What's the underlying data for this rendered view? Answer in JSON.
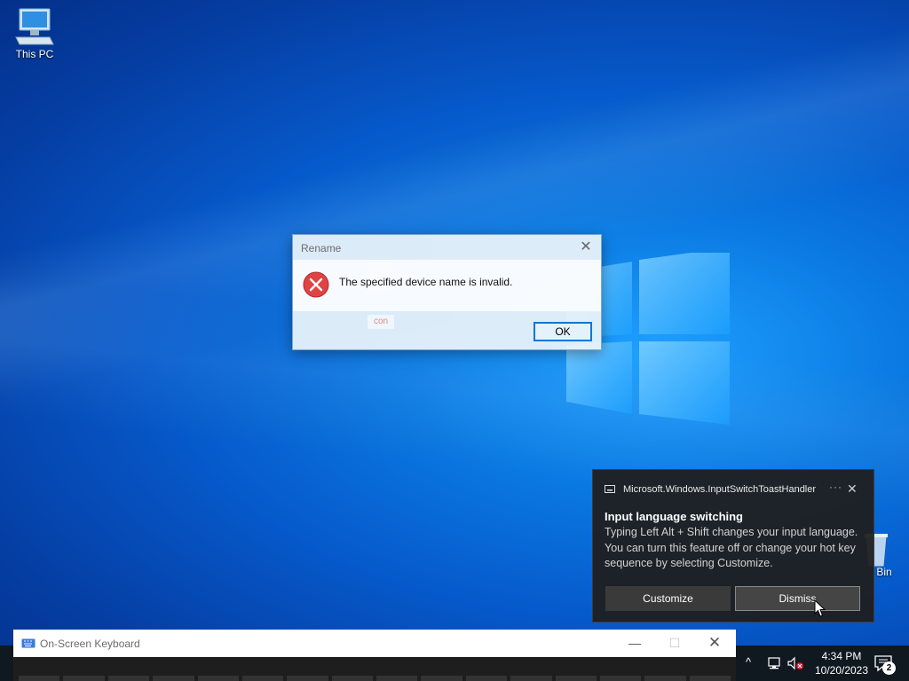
{
  "desktop": {
    "icons": [
      {
        "label": "This PC",
        "icon": "computer-icon"
      },
      {
        "label": "Bin",
        "icon": "recycle-bin-icon"
      }
    ]
  },
  "dialog": {
    "title": "Rename",
    "close_glyph": "✕",
    "message": "The specified device name is invalid.",
    "ghost_label": "con",
    "ok_label": "OK",
    "icon": "error-icon"
  },
  "toast": {
    "app_name": "Microsoft.Windows.InputSwitchToastHandler",
    "more_glyph": "···",
    "close_glyph": "✕",
    "title": "Input language switching",
    "body": "Typing Left Alt + Shift changes your input language. You can turn this feature off or change your hot key sequence by selecting Customize.",
    "customize_label": "Customize",
    "dismiss_label": "Dismiss"
  },
  "osk": {
    "title": "On-Screen Keyboard",
    "minimize_glyph": "—",
    "maximize_glyph": "☐",
    "close_glyph": "✕"
  },
  "taskbar": {
    "chevron_glyph": "^",
    "time": "4:34 PM",
    "date": "10/20/2023",
    "notification_count": "2"
  },
  "colors": {
    "accent": "#0078d7",
    "error": "#e81123",
    "taskbar": "#101820",
    "toast_bg": "#1f1f1f"
  }
}
